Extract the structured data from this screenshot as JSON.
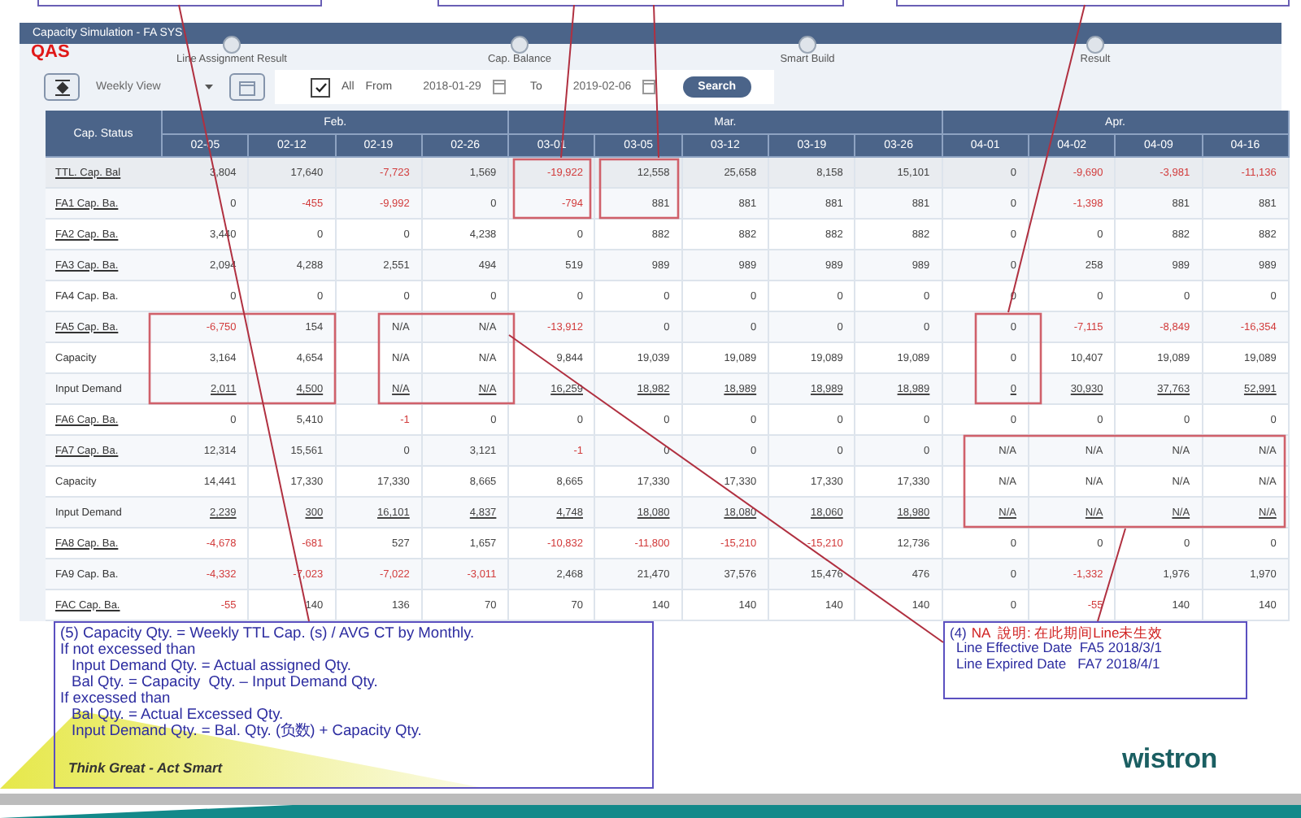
{
  "window": {
    "title": "Capacity Simulation - FA SYS",
    "badge": "QAS"
  },
  "steps": [
    {
      "label": "Line Assignment Result"
    },
    {
      "label": "Cap. Balance"
    },
    {
      "label": "Smart Build"
    },
    {
      "label": "Result"
    }
  ],
  "toolbar": {
    "view": "Weekly View",
    "all_checked": true,
    "all_label": "All",
    "from_label": "From",
    "from_date": "2018-01-29",
    "to_label": "To",
    "to_date": "2019-02-06",
    "search_label": "Search"
  },
  "table": {
    "corner": "Cap. Status",
    "months": [
      {
        "label": "Feb.",
        "weeks": [
          "02-05",
          "02-12",
          "02-19",
          "02-26"
        ]
      },
      {
        "label": "Mar.",
        "weeks": [
          "03-01",
          "03-05",
          "03-12",
          "03-19",
          "03-26"
        ]
      },
      {
        "label": "Apr.",
        "weeks": [
          "04-01",
          "04-02",
          "04-09",
          "04-16"
        ]
      }
    ],
    "rows": [
      {
        "label": "TTL. Cap. Bal",
        "kind": "total",
        "linked": true,
        "cells": [
          "3,804",
          "17,640",
          "-7,723",
          "1,569",
          "-19,922",
          "12,558",
          "25,658",
          "8,158",
          "15,101",
          "0",
          "-9,690",
          "-3,981",
          "-11,136"
        ],
        "negative": [
          false,
          false,
          true,
          false,
          true,
          false,
          false,
          false,
          false,
          false,
          true,
          true,
          true
        ]
      },
      {
        "label": "FA1 Cap. Ba.",
        "kind": "balance",
        "linked": true,
        "cells": [
          "0",
          "-455",
          "-9,992",
          "0",
          "-794",
          "881",
          "881",
          "881",
          "881",
          "0",
          "-1,398",
          "881",
          "881"
        ],
        "negative": [
          false,
          true,
          true,
          false,
          true,
          false,
          false,
          false,
          false,
          false,
          true,
          false,
          false
        ]
      },
      {
        "label": "FA2 Cap. Ba.",
        "kind": "balance",
        "linked": true,
        "cells": [
          "3,440",
          "0",
          "0",
          "4,238",
          "0",
          "882",
          "882",
          "882",
          "882",
          "0",
          "0",
          "882",
          "882"
        ],
        "negative": [
          false,
          false,
          false,
          false,
          false,
          false,
          false,
          false,
          false,
          false,
          false,
          false,
          false
        ]
      },
      {
        "label": "FA3 Cap. Ba.",
        "kind": "balance",
        "linked": true,
        "cells": [
          "2,094",
          "4,288",
          "2,551",
          "494",
          "519",
          "989",
          "989",
          "989",
          "989",
          "0",
          "258",
          "989",
          "989"
        ],
        "negative": [
          false,
          false,
          false,
          false,
          false,
          false,
          false,
          false,
          false,
          false,
          false,
          false,
          false
        ]
      },
      {
        "label": "FA4 Cap. Ba.",
        "kind": "balance",
        "linked": false,
        "cells": [
          "0",
          "0",
          "0",
          "0",
          "0",
          "0",
          "0",
          "0",
          "0",
          "0",
          "0",
          "0",
          "0"
        ],
        "negative": [
          false,
          false,
          false,
          false,
          false,
          false,
          false,
          false,
          false,
          false,
          false,
          false,
          false
        ]
      },
      {
        "label": "FA5 Cap. Ba.",
        "kind": "balance",
        "linked": true,
        "cells": [
          "-6,750",
          "154",
          "N/A",
          "N/A",
          "-13,912",
          "0",
          "0",
          "0",
          "0",
          "0",
          "-7,115",
          "-8,849",
          "-16,354"
        ],
        "negative": [
          true,
          false,
          false,
          false,
          true,
          false,
          false,
          false,
          false,
          false,
          true,
          true,
          true
        ]
      },
      {
        "label": "Capacity",
        "kind": "capacity",
        "linked": false,
        "cells": [
          "3,164",
          "4,654",
          "N/A",
          "N/A",
          "9,844",
          "19,039",
          "19,089",
          "19,089",
          "19,089",
          "0",
          "10,407",
          "19,089",
          "19,089"
        ],
        "negative": [
          false,
          false,
          false,
          false,
          false,
          false,
          false,
          false,
          false,
          false,
          false,
          false,
          false
        ]
      },
      {
        "label": "Input Demand",
        "kind": "demand",
        "linked": false,
        "cells": [
          "2,011",
          "4,500",
          "N/A",
          "N/A",
          "16,259",
          "18,982",
          "18,989",
          "18,989",
          "18,989",
          "0",
          "30,930",
          "37,763",
          "52,991"
        ],
        "negative": [
          false,
          false,
          false,
          false,
          false,
          false,
          false,
          false,
          false,
          false,
          false,
          false,
          false
        ]
      },
      {
        "label": "FA6 Cap. Ba.",
        "kind": "balance",
        "linked": true,
        "cells": [
          "0",
          "5,410",
          "-1",
          "0",
          "0",
          "0",
          "0",
          "0",
          "0",
          "0",
          "0",
          "0",
          "0"
        ],
        "negative": [
          false,
          false,
          true,
          false,
          false,
          false,
          false,
          false,
          false,
          false,
          false,
          false,
          false
        ]
      },
      {
        "label": "FA7 Cap. Ba.",
        "kind": "balance",
        "linked": true,
        "cells": [
          "12,314",
          "15,561",
          "0",
          "3,121",
          "-1",
          "0",
          "0",
          "0",
          "0",
          "N/A",
          "N/A",
          "N/A",
          "N/A"
        ],
        "negative": [
          false,
          false,
          false,
          false,
          true,
          false,
          false,
          false,
          false,
          false,
          false,
          false,
          false
        ]
      },
      {
        "label": "Capacity",
        "kind": "capacity",
        "linked": false,
        "cells": [
          "14,441",
          "17,330",
          "17,330",
          "8,665",
          "8,665",
          "17,330",
          "17,330",
          "17,330",
          "17,330",
          "N/A",
          "N/A",
          "N/A",
          "N/A"
        ],
        "negative": [
          false,
          false,
          false,
          false,
          false,
          false,
          false,
          false,
          false,
          false,
          false,
          false,
          false
        ]
      },
      {
        "label": "Input Demand",
        "kind": "demand",
        "linked": false,
        "cells": [
          "2,239",
          "300",
          "16,101",
          "4,837",
          "4,748",
          "18,080",
          "18,080",
          "18,060",
          "18,980",
          "N/A",
          "N/A",
          "N/A",
          "N/A"
        ],
        "negative": [
          false,
          false,
          false,
          false,
          false,
          false,
          false,
          false,
          false,
          false,
          false,
          false,
          false
        ]
      },
      {
        "label": "FA8 Cap. Ba.",
        "kind": "balance",
        "linked": true,
        "cells": [
          "-4,678",
          "-681",
          "527",
          "1,657",
          "-10,832",
          "-11,800",
          "-15,210",
          "-15,210",
          "12,736",
          "0",
          "0",
          "0",
          "0"
        ],
        "negative": [
          true,
          true,
          false,
          false,
          true,
          true,
          true,
          true,
          false,
          false,
          false,
          false,
          false
        ]
      },
      {
        "label": "FA9 Cap. Ba.",
        "kind": "balance",
        "linked": false,
        "cells": [
          "-4,332",
          "-7,023",
          "-7,022",
          "-3,011",
          "2,468",
          "21,470",
          "37,576",
          "15,476",
          "476",
          "0",
          "-1,332",
          "1,976",
          "1,970"
        ],
        "negative": [
          true,
          true,
          true,
          true,
          false,
          false,
          false,
          false,
          false,
          false,
          true,
          false,
          false
        ]
      },
      {
        "label": "FAC Cap. Ba.",
        "kind": "balance",
        "linked": true,
        "cells": [
          "-55",
          "140",
          "136",
          "70",
          "70",
          "140",
          "140",
          "140",
          "140",
          "0",
          "-55",
          "140",
          "140"
        ],
        "negative": [
          true,
          false,
          false,
          false,
          false,
          false,
          false,
          false,
          false,
          false,
          true,
          false,
          false
        ]
      }
    ]
  },
  "formula_note": {
    "lines": [
      {
        "text": "(5) Capacity Qty. = Weekly TTL Cap. (s) / AVG CT by Monthly.",
        "indented": false
      },
      {
        "text": "If not excessed than",
        "indented": false
      },
      {
        "text": "Input Demand Qty. = Actual assigned Qty.",
        "indented": true
      },
      {
        "text": "Bal Qty. = Capacity  Qty. – Input Demand Qty.",
        "indented": true
      },
      {
        "text": "If excessed than",
        "indented": false
      },
      {
        "text": "Bal Qty. = Actual Excessed Qty.",
        "indented": true
      },
      {
        "text": "Input Demand Qty. = Bal. Qty. (负数) + Capacity Qty.",
        "indented": true
      }
    ],
    "slogan": "Think Great - Act Smart"
  },
  "na_note": {
    "number": "(4)",
    "title": "NA  說明: 在此期间Line未生效",
    "lines": [
      "Line Effective Date  FA5 2018/3/1",
      "Line Expired Date   FA7 2018/4/1"
    ]
  },
  "logo": {
    "text": "wistron"
  }
}
